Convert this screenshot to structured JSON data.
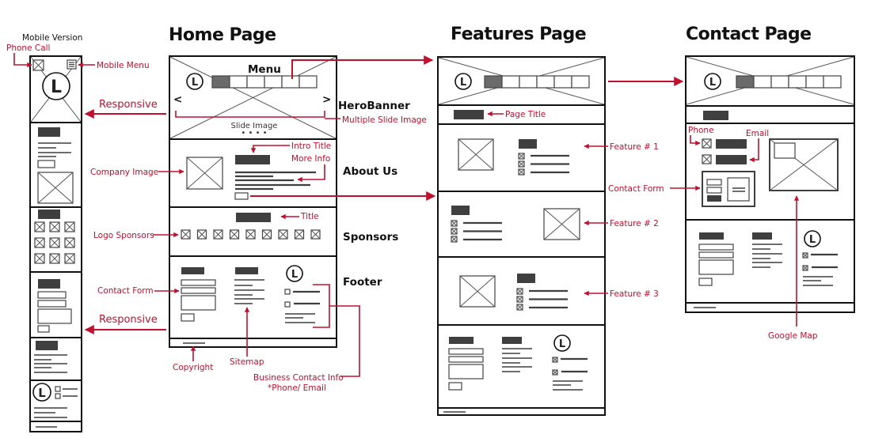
{
  "titles": {
    "mobile": "Mobile Version",
    "home": "Home Page",
    "features": "Features Page",
    "contact": "Contact Page"
  },
  "sections": {
    "menu": "Menu",
    "hero": "HeroBanner",
    "about": "About Us",
    "sponsors": "Sponsors",
    "footer": "Footer"
  },
  "hero": {
    "prev": "<",
    "next": ">",
    "slide_caption": "Slide Image",
    "dots": "• • • •"
  },
  "logo_letter": "L",
  "annotations": {
    "phone_call": "Phone Call",
    "mobile_menu": "Mobile Menu",
    "responsive_top": "Responsive",
    "responsive_bottom": "Responsive",
    "multiple_slide": "Multiple Slide Image",
    "intro_title": "Intro Title",
    "more_info": "More Info",
    "company_image": "Company Image",
    "title": "Title",
    "logo_sponsors": "Logo Sponsors",
    "contact_form": "Contact Form",
    "copyright": "Copyright",
    "sitemap": "Sitemap",
    "business_contact_1": "Business Contact Info",
    "business_contact_2": "*Phone/ Email",
    "page_title": "Page Title",
    "feature_1": "Feature # 1",
    "feature_2": "Feature # 2",
    "feature_3": "Feature # 3",
    "contact_form_contact": "Contact Form",
    "phone": "Phone",
    "email": "Email",
    "google_map": "Google Map"
  },
  "colors": {
    "accent": "#c0102e",
    "block": "#3f3f3f",
    "frame": "#111111"
  }
}
